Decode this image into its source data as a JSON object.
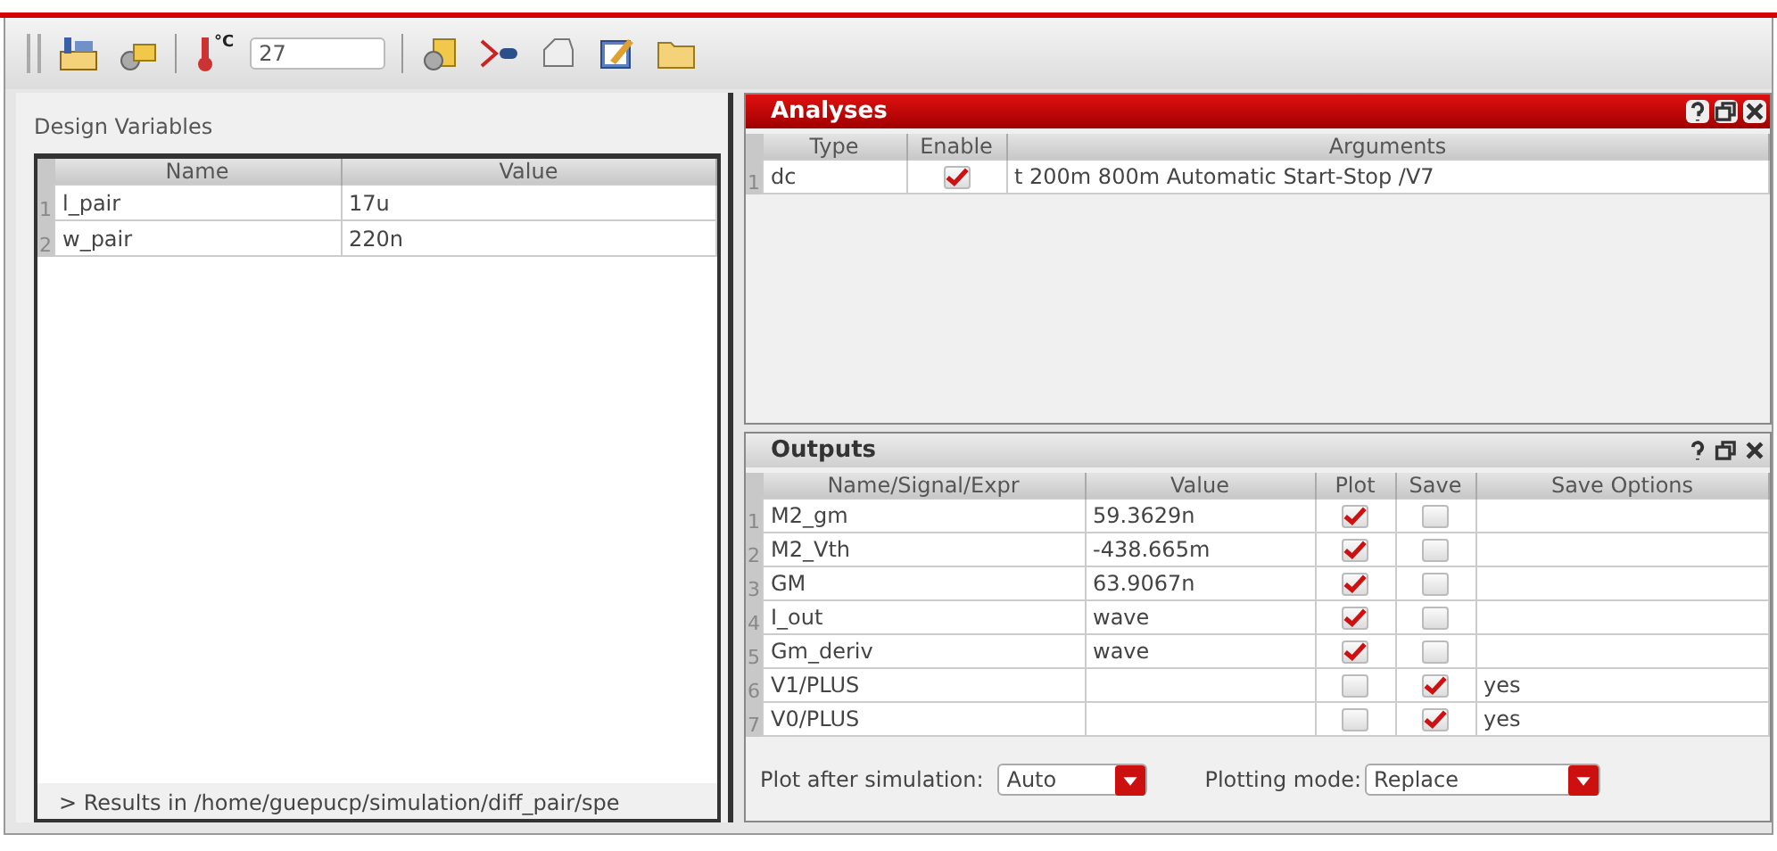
{
  "toolbar": {
    "temperature_unit": "°C",
    "temperature": "27"
  },
  "design_variables": {
    "title": "Design Variables",
    "columns": [
      "Name",
      "Value"
    ],
    "rows": [
      {
        "index": "1",
        "name": "l_pair",
        "value": "17u"
      },
      {
        "index": "2",
        "name": "w_pair",
        "value": "220n"
      }
    ],
    "status": "> Results in /home/guepucp/simulation/diff_pair/spe"
  },
  "analyses": {
    "title": "Analyses",
    "columns": [
      "Type",
      "Enable",
      "Arguments"
    ],
    "rows": [
      {
        "index": "1",
        "type": "dc",
        "enabled": true,
        "arguments": "t 200m 800m Automatic Start-Stop /V7"
      }
    ]
  },
  "outputs": {
    "title": "Outputs",
    "columns": [
      "Name/Signal/Expr",
      "Value",
      "Plot",
      "Save",
      "Save Options"
    ],
    "rows": [
      {
        "index": "1",
        "name": "M2_gm",
        "value": "59.3629n",
        "plot": true,
        "save": false
      },
      {
        "index": "2",
        "name": "M2_Vth",
        "value": "-438.665m",
        "plot": true,
        "save": false
      },
      {
        "index": "3",
        "name": "GM",
        "value": "63.9067n",
        "plot": true,
        "save": false
      },
      {
        "index": "4",
        "name": "I_out",
        "value": "wave",
        "plot": true,
        "save": false
      },
      {
        "index": "5",
        "name": "Gm_deriv",
        "value": "wave",
        "plot": true,
        "save": false
      },
      {
        "index": "6",
        "name": "V1/PLUS",
        "plot": false,
        "save": true,
        "save_options": "yes"
      },
      {
        "index": "7",
        "name": "V0/PLUS",
        "plot": false,
        "save": true,
        "save_options": "yes"
      }
    ],
    "plot_after_label": "Plot after simulation:",
    "plot_after_value": "Auto",
    "plotting_mode_label": "Plotting mode:",
    "plotting_mode_value": "Replace"
  }
}
